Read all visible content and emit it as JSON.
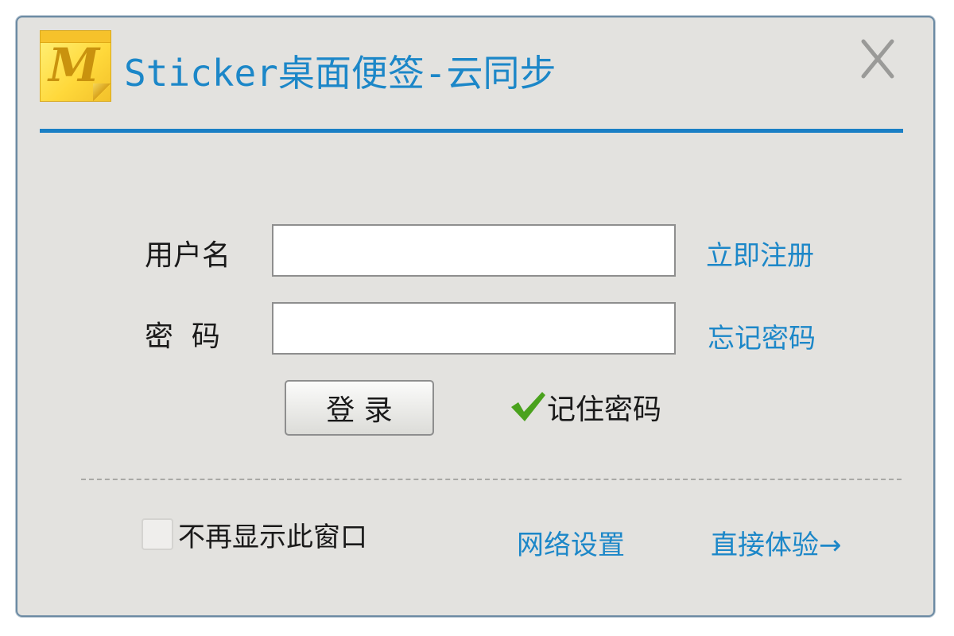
{
  "window": {
    "title": "Sticker桌面便签-云同步",
    "logo_letter": "M",
    "close_label": "X"
  },
  "form": {
    "username_label": "用户名",
    "password_label": "密  码",
    "username_value": "",
    "password_value": "",
    "register_link": "立即注册",
    "forgot_link": "忘记密码",
    "login_button": "登 录",
    "remember_label": "记住密码",
    "remember_checked": true
  },
  "footer": {
    "no_show_label": "不再显示此窗口",
    "no_show_checked": false,
    "network_settings": "网络设置",
    "try_direct": "直接体验→"
  },
  "colors": {
    "accent": "#1a7fc5",
    "link": "#1c87c8",
    "background": "#e3e2df",
    "check": "#4aa21d"
  },
  "icons": {
    "logo": "sticky-note-icon",
    "close": "close-icon",
    "remember": "checkmark-icon"
  }
}
